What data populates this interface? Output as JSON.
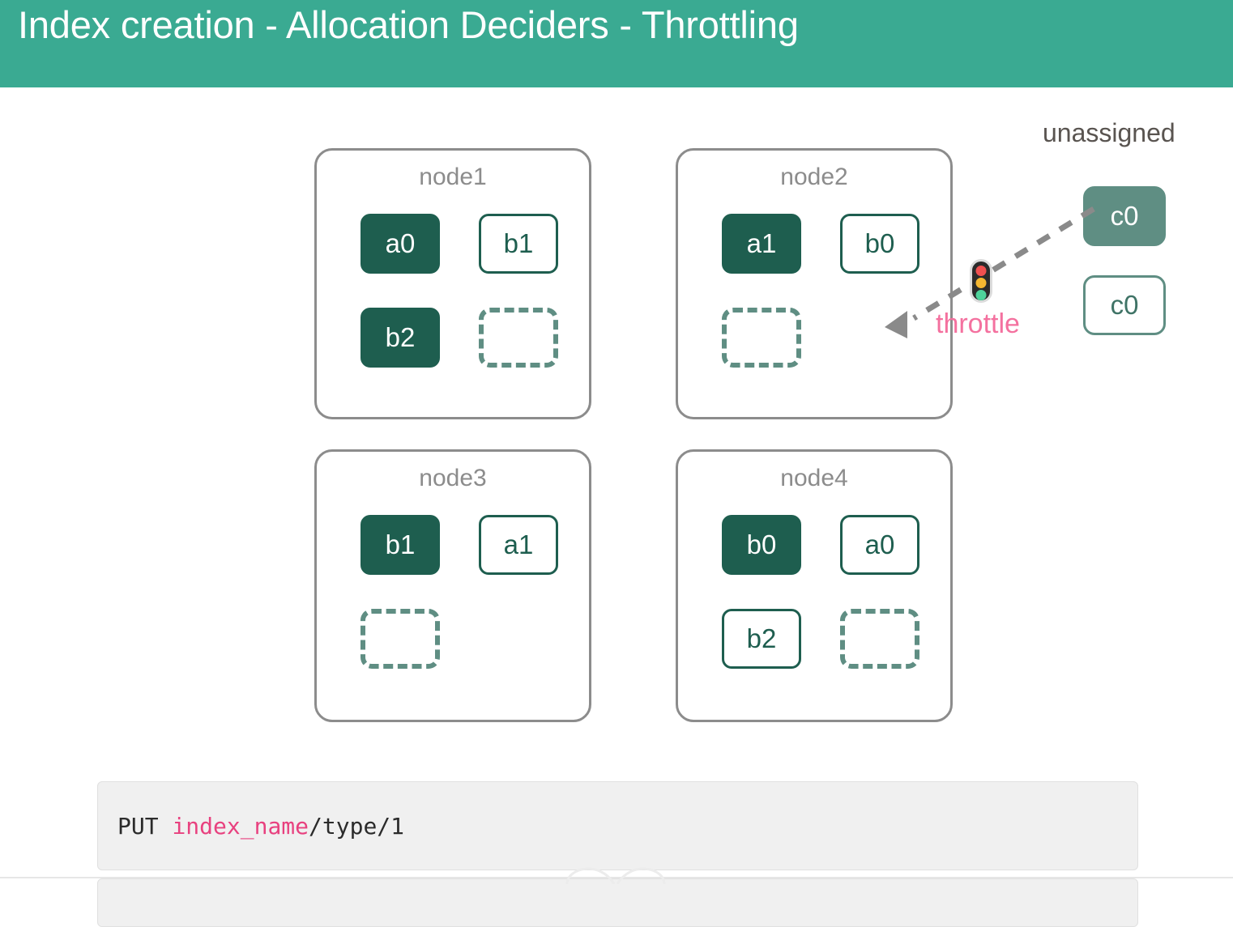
{
  "header": {
    "title": "Index creation - Allocation Deciders - Throttling",
    "background_color": "#3aaa92",
    "text_color": "#ffffff"
  },
  "colors": {
    "primary_shard": "#1e5e4f",
    "replica_shard_border": "#1e5e4f",
    "unassigned_primary": "#5f8e83",
    "empty_slot_dash": "#5f8e83",
    "node_border": "#8c8c8c",
    "node_label": "#8c8c8c",
    "throttle_text": "#f4719f",
    "code_background": "#f0f0f0",
    "code_index_name": "#e8417f"
  },
  "diagram": {
    "nodes": [
      {
        "label": "node1",
        "slots": [
          {
            "position": "top-left",
            "text": "a0",
            "state": "primary"
          },
          {
            "position": "top-right",
            "text": "b1",
            "state": "replica"
          },
          {
            "position": "bottom-left",
            "text": "b2",
            "state": "primary"
          },
          {
            "position": "bottom-right",
            "text": "",
            "state": "empty"
          }
        ]
      },
      {
        "label": "node2",
        "slots": [
          {
            "position": "top-left",
            "text": "a1",
            "state": "primary"
          },
          {
            "position": "top-right",
            "text": "b0",
            "state": "replica"
          },
          {
            "position": "bottom-left",
            "text": "",
            "state": "empty"
          }
        ]
      },
      {
        "label": "node3",
        "slots": [
          {
            "position": "top-left",
            "text": "b1",
            "state": "primary"
          },
          {
            "position": "top-right",
            "text": "a1",
            "state": "replica"
          },
          {
            "position": "bottom-left",
            "text": "",
            "state": "empty"
          }
        ]
      },
      {
        "label": "node4",
        "slots": [
          {
            "position": "top-left",
            "text": "b0",
            "state": "primary"
          },
          {
            "position": "top-right",
            "text": "a0",
            "state": "replica"
          },
          {
            "position": "bottom-left",
            "text": "b2",
            "state": "replica"
          },
          {
            "position": "bottom-right",
            "text": "",
            "state": "empty"
          }
        ]
      }
    ],
    "unassigned": {
      "label": "unassigned",
      "shards": [
        {
          "text": "c0",
          "state": "primary"
        },
        {
          "text": "c0",
          "state": "replica"
        }
      ]
    },
    "annotation": {
      "throttle_label": "throttle",
      "traffic_light_icon": "traffic-light-icon",
      "lamps": [
        "red",
        "amber",
        "green"
      ]
    }
  },
  "code": {
    "line1": {
      "method": "PUT ",
      "index_name": "index_name",
      "path": "/type/1"
    }
  }
}
